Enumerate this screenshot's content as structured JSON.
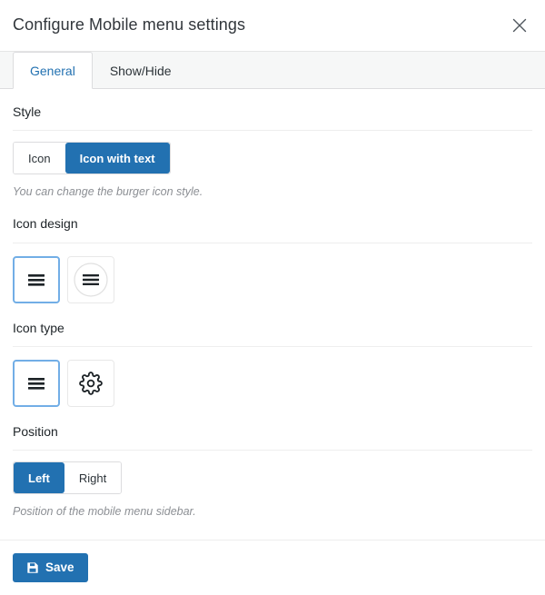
{
  "header": {
    "title": "Configure Mobile menu settings",
    "close_icon": "close-icon"
  },
  "tabs": [
    {
      "label": "General",
      "active": true
    },
    {
      "label": "Show/Hide",
      "active": false
    }
  ],
  "sections": {
    "style": {
      "label": "Style",
      "options": [
        {
          "label": "Icon",
          "active": false
        },
        {
          "label": "Icon with text",
          "active": true
        }
      ],
      "helper": "You can change the burger icon style."
    },
    "icon_design": {
      "label": "Icon design",
      "options": [
        {
          "icon": "hamburger-icon",
          "active": true
        },
        {
          "icon": "hamburger-circle-icon",
          "active": false
        }
      ]
    },
    "icon_type": {
      "label": "Icon type",
      "options": [
        {
          "icon": "hamburger-icon",
          "active": true
        },
        {
          "icon": "gear-icon",
          "active": false
        }
      ]
    },
    "position": {
      "label": "Position",
      "options": [
        {
          "label": "Left",
          "active": true
        },
        {
          "label": "Right",
          "active": false
        }
      ],
      "helper": "Position of the mobile menu sidebar."
    }
  },
  "footer": {
    "save_label": "Save",
    "save_icon": "floppy-disk-icon"
  },
  "colors": {
    "accent": "#2271b1",
    "accent_border": "#72aee6",
    "tab_bar_bg": "#f6f7f7",
    "divider": "#eeeeee",
    "title_text": "#32373c",
    "helper_text": "#8c8f94"
  }
}
